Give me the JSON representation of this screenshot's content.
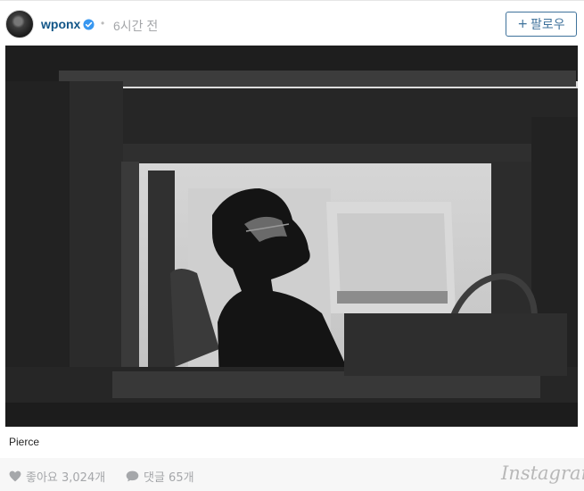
{
  "header": {
    "username": "wponx",
    "separator": "•",
    "time": "6시간 전",
    "follow_label": "팔로우",
    "follow_prefix": "+"
  },
  "icons": {
    "avatar": "profile-photo",
    "verified": "verified-badge-icon",
    "like": "heart-icon",
    "comment": "speech-bubble-icon"
  },
  "photo": {
    "description_icon": "black-and-white-photo"
  },
  "caption": "Pierce",
  "footer": {
    "likes": "좋아요 3,024개",
    "comments": "댓글 65개",
    "brand": "Instagram"
  },
  "colors": {
    "username": "#125688",
    "follow": "#3f729b",
    "verified": "#3897f0",
    "muted": "#a5a7aa"
  }
}
